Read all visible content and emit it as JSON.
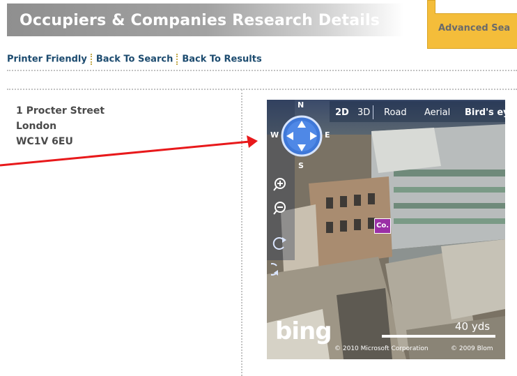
{
  "header": {
    "title": "Occupiers & Companies Research Details",
    "advanced_search_label": "Advanced Sea"
  },
  "nav_links": {
    "printer_friendly": "Printer Friendly",
    "back_to_search": "Back To Search",
    "back_to_results": "Back To Results"
  },
  "address": {
    "line1": "1 Procter Street",
    "line2": "London",
    "line3": "WC1V 6EU"
  },
  "map": {
    "compass": {
      "n": "N",
      "s": "S",
      "e": "E",
      "w": "W"
    },
    "modes": {
      "d2": "2D",
      "d3": "3D",
      "road": "Road",
      "aerial": "Aerial",
      "birds_eye": "Bird's ey"
    },
    "marker_label": "Co.",
    "scale_label": "40 yds",
    "logo": "bing",
    "copyright1": "© 2010 Microsoft Corporation",
    "copyright2": "© 2009 Blom"
  },
  "colors": {
    "accent_yellow": "#f4bd3a",
    "link_blue": "#1c4b6f",
    "arrow_red": "#e8191b",
    "marker_purple": "#9b2fa6"
  }
}
